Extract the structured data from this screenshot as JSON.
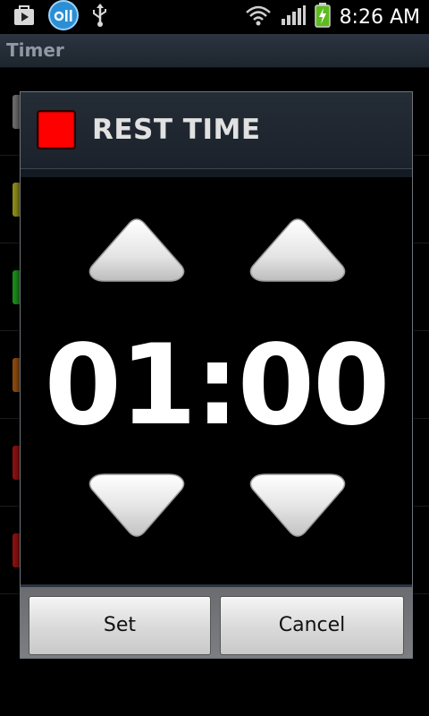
{
  "statusbar": {
    "icons": [
      "play-store-icon",
      "app-circle-icon",
      "usb-icon",
      "wifi-icon",
      "signal-icon",
      "battery-charging-icon"
    ],
    "clock": "8:26 AM",
    "app_circle_text": "o||"
  },
  "appbar": {
    "title": "Timer"
  },
  "background_list": {
    "swatch_colors": [
      "#6a6a6a",
      "#8a8a1a",
      "#1a8a1a",
      "#8a4a10",
      "#8a1010",
      "#8a1010"
    ]
  },
  "dialog": {
    "title": "REST TIME",
    "color": "#ff0000",
    "time": "01:00",
    "buttons": {
      "set": "Set",
      "cancel": "Cancel"
    }
  }
}
